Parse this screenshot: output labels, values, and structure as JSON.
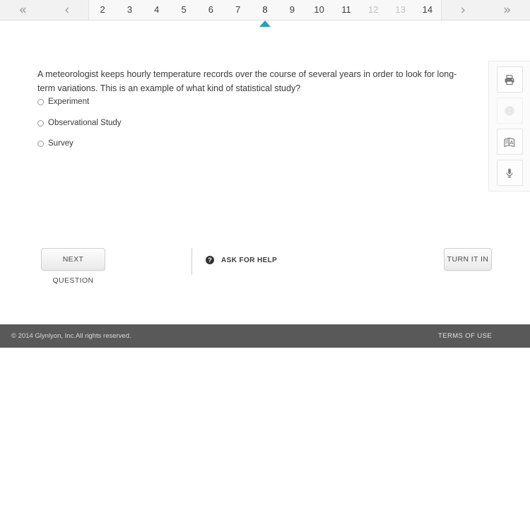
{
  "pager": {
    "first_icon": "«",
    "prev_icon": "‹",
    "next_icon": "›",
    "last_icon": "»",
    "pages": [
      {
        "label": "2",
        "state": "enabled"
      },
      {
        "label": "3",
        "state": "enabled"
      },
      {
        "label": "4",
        "state": "enabled"
      },
      {
        "label": "5",
        "state": "enabled"
      },
      {
        "label": "6",
        "state": "enabled"
      },
      {
        "label": "7",
        "state": "enabled"
      },
      {
        "label": "8",
        "state": "active"
      },
      {
        "label": "9",
        "state": "enabled"
      },
      {
        "label": "10",
        "state": "enabled"
      },
      {
        "label": "11",
        "state": "enabled"
      },
      {
        "label": "12",
        "state": "disabled"
      },
      {
        "label": "13",
        "state": "disabled"
      },
      {
        "label": "14",
        "state": "enabled"
      }
    ],
    "active_page": "8",
    "indicator_color": "#23a2c0"
  },
  "question": {
    "text": "A meteorologist keeps hourly temperature records over the course of several years in order to look for long-term variations. This is an example of what kind of statistical study?",
    "choices": [
      {
        "label": "Experiment",
        "selected": false
      },
      {
        "label": "Observational Study",
        "selected": false
      },
      {
        "label": "Survey",
        "selected": false
      }
    ]
  },
  "toolrail": {
    "buttons": [
      {
        "icon": "print-icon",
        "enabled": true
      },
      {
        "icon": "globe-icon",
        "enabled": false
      },
      {
        "icon": "translate-icon",
        "enabled": true
      },
      {
        "icon": "microphone-icon",
        "enabled": true
      }
    ]
  },
  "actions": {
    "next_label": "NEXT QUESTION",
    "help_label": "ASK FOR HELP",
    "help_glyph": "?",
    "turn_in_label": "TURN IT IN"
  },
  "footer": {
    "copyright": "© 2014 Glynlyon, Inc.All rights reserved.",
    "terms_label": "TERMS OF USE",
    "background": "#595959"
  }
}
